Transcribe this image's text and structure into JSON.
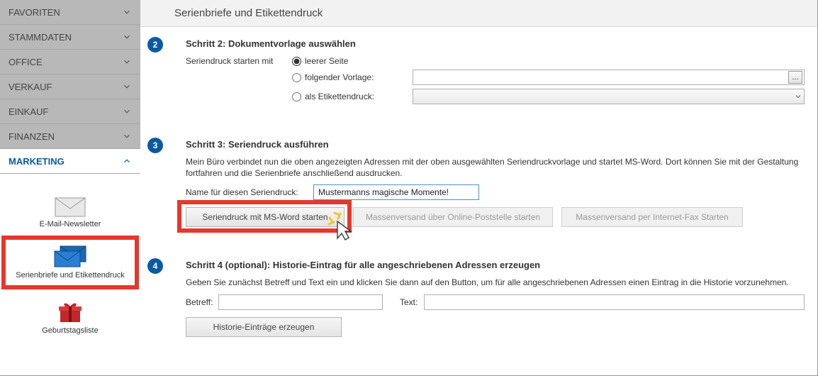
{
  "sidebar": {
    "groups": [
      {
        "label": "FAVORITEN"
      },
      {
        "label": "STAMMDATEN"
      },
      {
        "label": "OFFICE"
      },
      {
        "label": "VERKAUF"
      },
      {
        "label": "EINKAUF"
      },
      {
        "label": "FINANZEN"
      }
    ],
    "activeGroup": "MARKETING",
    "tiles": {
      "newsletter": "E-Mail-Newsletter",
      "serienbriefe": "Serienbriefe und Etikettendruck",
      "geburtstag": "Geburtstagsliste"
    }
  },
  "page": {
    "title": "Serienbriefe und Etikettendruck"
  },
  "step2": {
    "title": "Schritt 2: Dokumentvorlage auswählen",
    "lead_label": "Seriendruck starten mit",
    "radio_blank": "leerer Seite",
    "radio_template": "folgender Vorlage:",
    "radio_label": "als Etikettendruck:",
    "browse": "..."
  },
  "step3": {
    "title": "Schritt 3: Seriendruck ausführen",
    "desc": "Mein Büro verbindet nun die oben angezeigten Adressen mit der oben ausgewählten Seriendruckvorlage und startet MS-Word. Dort können Sie mit der Gestaltung fortfahren und die Serienbriefe anschließend ausdrucken.",
    "name_label": "Name für diesen Seriendruck:",
    "name_value": "Mustermanns magische Momente!",
    "btn_word": "Seriendruck mit MS-Word starten",
    "btn_mass": "Massenversand über Online-Poststelle starten",
    "btn_fax": "Massenversand per Internet-Fax Starten"
  },
  "step4": {
    "title": "Schritt 4 (optional): Historie-Eintrag für alle angeschriebenen Adressen erzeugen",
    "desc": "Geben Sie zunächst Betreff und Text ein und klicken Sie dann auf den Button, um für alle angeschriebenen Adressen einen Eintrag in die Historie vorzunehmen.",
    "betreff_label": "Betreff:",
    "text_label": "Text:",
    "btn_hist": "Historie-Einträge erzeugen"
  }
}
